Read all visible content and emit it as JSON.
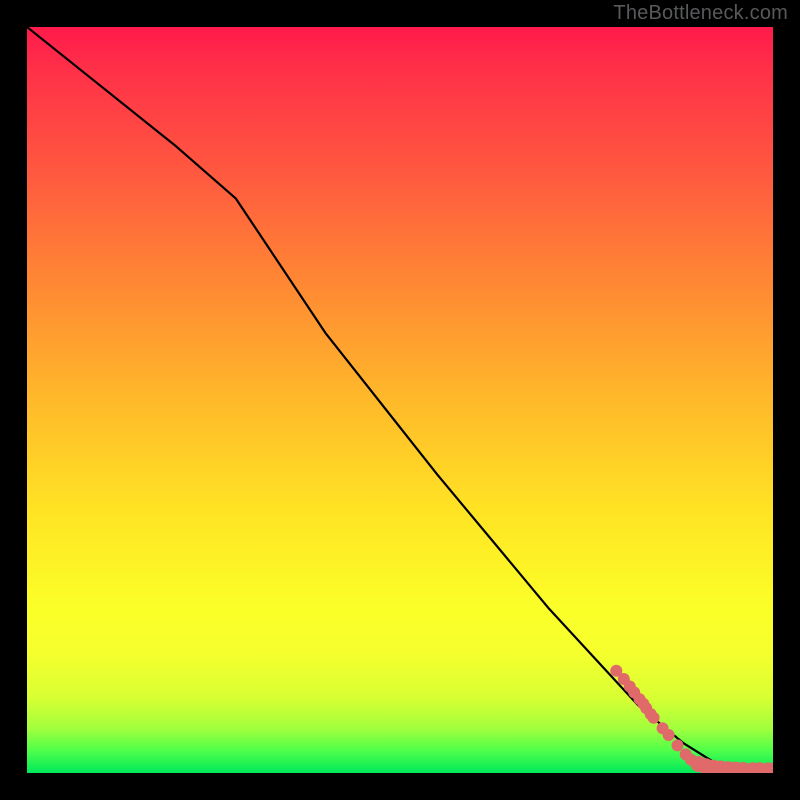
{
  "watermark": "TheBottleneck.com",
  "chart_data": {
    "type": "line",
    "title": "",
    "xlabel": "",
    "ylabel": "",
    "xlim": [
      0,
      100
    ],
    "ylim": [
      0,
      100
    ],
    "grid": false,
    "gradient_stops": [
      {
        "pos": 0.0,
        "color": "#ff1a4b"
      },
      {
        "pos": 0.2,
        "color": "#ff5a3f"
      },
      {
        "pos": 0.5,
        "color": "#ffb92a"
      },
      {
        "pos": 0.78,
        "color": "#fbff28"
      },
      {
        "pos": 0.94,
        "color": "#a2ff3c"
      },
      {
        "pos": 1.0,
        "color": "#00e85a"
      }
    ],
    "series": [
      {
        "name": "curve",
        "type": "line",
        "x": [
          0,
          10,
          20,
          28,
          40,
          55,
          70,
          82,
          88,
          92,
          95,
          100
        ],
        "y": [
          100,
          92,
          84,
          77,
          59,
          40,
          22,
          9,
          4,
          1.5,
          0.8,
          0.6
        ]
      },
      {
        "name": "points",
        "type": "scatter",
        "marker": "circle",
        "color": "#e06a6a",
        "x": [
          79,
          80,
          80.8,
          81.4,
          82.1,
          82.6,
          83.0,
          83.6,
          84.0,
          85.2,
          86.0,
          87.2,
          88.3,
          89.0,
          90.0,
          91.0,
          92.0,
          93.0,
          94.0,
          95.0,
          96.0,
          97.3,
          98.2,
          99.4,
          100.2,
          101.0
        ],
        "y": [
          13.7,
          12.6,
          11.6,
          10.8,
          9.9,
          9.3,
          8.7,
          7.9,
          7.4,
          6.0,
          5.1,
          3.7,
          2.5,
          1.8,
          1.2,
          0.9,
          0.7,
          0.6,
          0.5,
          0.45,
          0.4,
          0.37,
          0.36,
          0.35,
          0.34,
          0.33
        ],
        "r": [
          6,
          6,
          6,
          6,
          6,
          6,
          6,
          6,
          6,
          6,
          6,
          6,
          6,
          6,
          8,
          8,
          8,
          8,
          8,
          8,
          8,
          8,
          8,
          8,
          8,
          8
        ]
      }
    ]
  }
}
